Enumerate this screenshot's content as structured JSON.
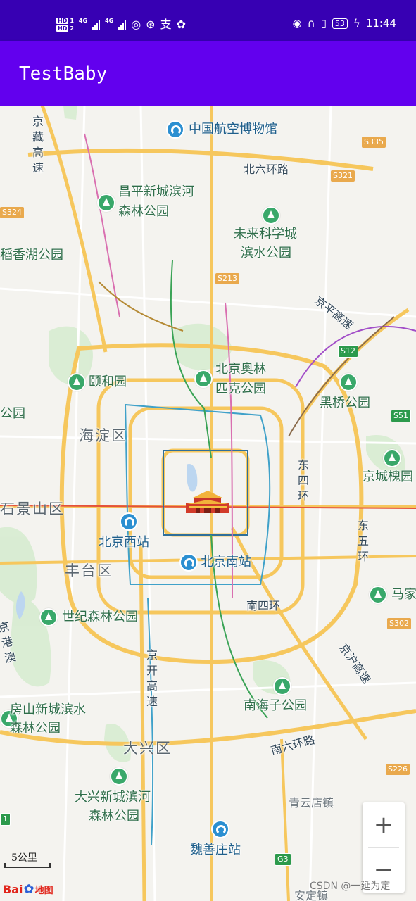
{
  "status_bar": {
    "hd1": "HD",
    "hd1_num": "1",
    "hd2": "HD",
    "hd2_num": "2",
    "net1": "4G",
    "net2": "4G",
    "battery": "53",
    "time": "11:44"
  },
  "app_bar": {
    "title": "TestBaby"
  },
  "map": {
    "pois": [
      {
        "id": "aviation",
        "text": "中国航空博物馆"
      },
      {
        "id": "changping",
        "text": "昌平新城滨河"
      },
      {
        "id": "changping2",
        "text": "森林公园"
      },
      {
        "id": "weilai",
        "text": "未来科学城"
      },
      {
        "id": "weilai2",
        "text": "滨水公园"
      },
      {
        "id": "daoxiang",
        "text": "稻香湖公园"
      },
      {
        "id": "yiheyuan",
        "text": "颐和园"
      },
      {
        "id": "olympic",
        "text": "北京奥林"
      },
      {
        "id": "olympic2",
        "text": "匹克公园"
      },
      {
        "id": "heiqiao",
        "text": "黑桥公园"
      },
      {
        "id": "jingchenghuai",
        "text": "京城槐园"
      },
      {
        "id": "gongyuan_left",
        "text": "公园"
      },
      {
        "id": "beijingxi",
        "text": "北京西站"
      },
      {
        "id": "beijingnan",
        "text": "北京南站"
      },
      {
        "id": "shiji",
        "text": "世纪森林公园"
      },
      {
        "id": "majia",
        "text": "马家"
      },
      {
        "id": "nanhaizi",
        "text": "南海子公园"
      },
      {
        "id": "fangshan",
        "text": "房山新城滨水"
      },
      {
        "id": "fangshan2",
        "text": "森林公园"
      },
      {
        "id": "daxing",
        "text": "大兴新城滨河"
      },
      {
        "id": "daxing2",
        "text": "森林公园"
      },
      {
        "id": "weishanzhuang",
        "text": "魏善庄站"
      }
    ],
    "districts": {
      "haidian": "海淀区",
      "shijingshan": "石景山区",
      "fengtai": "丰台区",
      "daxing": "大兴区"
    },
    "roads": {
      "north6": "北六环路",
      "south6": "南六环路",
      "south4": "南四环",
      "jingzang": "京藏高速",
      "jingping": "京平高速",
      "east4": "东四环",
      "east5": "东五环",
      "jinghu": "京沪高速",
      "jingkai": "京开高速",
      "jinggang": "京港澳"
    },
    "towns": {
      "qingyundian": "青云店镇",
      "anding": "安定镇"
    },
    "shields": {
      "s335": "S335",
      "s321": "S321",
      "s324": "S324",
      "s213": "S213",
      "s12": "S12",
      "s51": "S51",
      "s302": "S302",
      "s226": "S226",
      "g3": "G3",
      "s1": "1"
    }
  },
  "controls": {
    "zoom_in": "+",
    "zoom_out": "−",
    "scale": "5公里"
  },
  "branding": {
    "logo_bai": "Bai",
    "logo_paw": "✿",
    "logo_map": "地图",
    "watermark": "CSDN @一延为定"
  },
  "colors": {
    "status_bar": "#3700B3",
    "app_bar": "#6200EE",
    "park_green": "#39a86a",
    "station_blue": "#2b8fd1",
    "road_yellow": "#f6c75d"
  }
}
